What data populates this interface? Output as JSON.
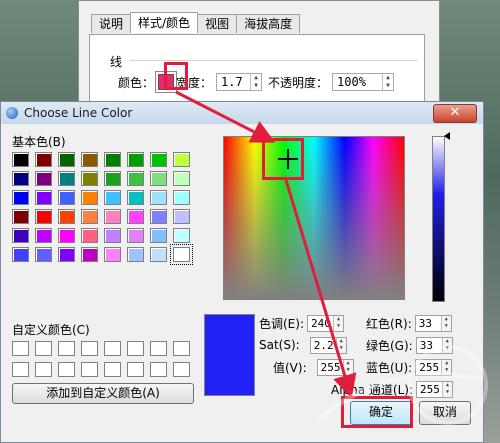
{
  "style_window": {
    "tabs": [
      {
        "label": "说明",
        "active": false
      },
      {
        "label": "样式/颜色",
        "active": true
      },
      {
        "label": "视图",
        "active": false
      },
      {
        "label": "海拔高度",
        "active": false
      }
    ],
    "group_title": "线",
    "color_label": "颜色：",
    "width_label": "宽度：",
    "width_value": "1.7",
    "opacity_label": "不透明度：",
    "opacity_value": "100%",
    "line_color": "#e62a6e"
  },
  "dialog": {
    "title": "Choose Line Color",
    "close_glyph": "✕",
    "basic_colors_label": "基本色(B)",
    "basic_colors": [
      "#000000",
      "#800000",
      "#006400",
      "#8b5a00",
      "#008000",
      "#00a000",
      "#00c000",
      "#c0ff40",
      "#000080",
      "#800080",
      "#008080",
      "#808000",
      "#20a020",
      "#40c040",
      "#80e080",
      "#c0ffc0",
      "#0000ff",
      "#8000ff",
      "#4060ff",
      "#ff8000",
      "#40c0ff",
      "#00c0c0",
      "#a0e0ff",
      "#a0ffff",
      "#800000",
      "#ff0000",
      "#ff4000",
      "#ff8040",
      "#ff80c0",
      "#ff40ff",
      "#8080ff",
      "#c0c0ff",
      "#4000c0",
      "#c000ff",
      "#ff00ff",
      "#ff6080",
      "#c080ff",
      "#e080ff",
      "#80c0ff",
      "#c0ffff",
      "#4040ff",
      "#6060ff",
      "#8000ff",
      "#c000c0",
      "#ff80ff",
      "#a0c0ff",
      "#c0e0ff",
      "#ffffff"
    ],
    "custom_colors_label": "自定义颜色(C)",
    "add_custom_label": "添加到自定义颜色(A)",
    "fields": {
      "hue": {
        "label": "色调(E):",
        "value": "240"
      },
      "sat": {
        "label": "Sat(S):",
        "value": "2.2"
      },
      "lum": {
        "label": "值(V):",
        "value": "255"
      },
      "red": {
        "label": "红色(R):",
        "value": "33"
      },
      "green": {
        "label": "绿色(G):",
        "value": "33"
      },
      "blue": {
        "label": "蓝色(U):",
        "value": "255"
      },
      "alpha": {
        "label": "Alpha 通道(L):",
        "value": "255"
      }
    },
    "preview_color": "#2121f5",
    "ok_label": "确定",
    "cancel_label": "取消"
  },
  "annotation_color": "#e01e3c"
}
